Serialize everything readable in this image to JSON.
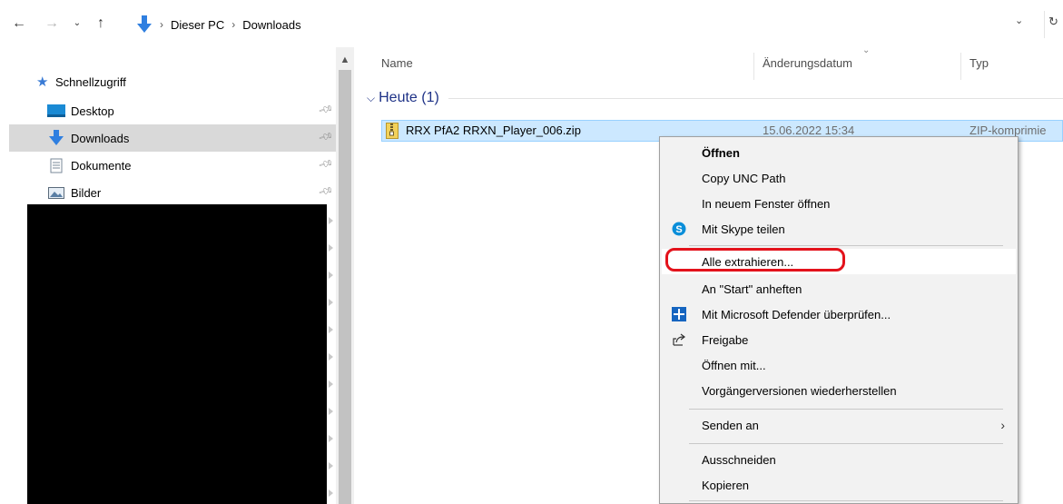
{
  "address_bar": {
    "back_icon": "arrow-left-icon",
    "forward_icon": "arrow-right-icon",
    "recent_icon": "chevron-down-icon",
    "up_icon": "arrow-up-icon",
    "breadcrumbs": [
      "Dieser PC",
      "Downloads"
    ],
    "refresh_icon": "refresh-icon"
  },
  "nav_pane": {
    "quick_access": "Schnellzugriff",
    "items": [
      {
        "label": "Desktop",
        "icon": "desktop-icon"
      },
      {
        "label": "Downloads",
        "icon": "download-arrow-icon",
        "selected": true
      },
      {
        "label": "Dokumente",
        "icon": "document-icon"
      },
      {
        "label": "Bilder",
        "icon": "pictures-icon"
      }
    ]
  },
  "file_list": {
    "columns": [
      "Name",
      "Änderungsdatum",
      "Typ"
    ],
    "group": {
      "title": "Heute (1)"
    },
    "files": [
      {
        "name": "RRX PfA2 RRXN_Player_006.zip",
        "date": "15.06.2022 15:34",
        "type": "ZIP-komprimie"
      }
    ]
  },
  "context_menu": {
    "items": [
      {
        "label": "Öffnen",
        "bold": true
      },
      {
        "label": "Copy UNC Path"
      },
      {
        "label": "In neuem Fenster öffnen"
      },
      {
        "label": "Mit Skype teilen",
        "icon": "skype-icon"
      },
      {
        "label": "Alle extrahieren..."
      },
      {
        "label": "An \"Start\" anheften"
      },
      {
        "label": "Mit Microsoft Defender überprüfen...",
        "icon": "defender-shield-icon"
      },
      {
        "label": "Freigabe",
        "icon": "share-icon"
      },
      {
        "label": "Öffnen mit..."
      },
      {
        "label": "Vorgängerversionen wiederherstellen"
      },
      {
        "label": "Senden an",
        "submenu": true
      },
      {
        "label": "Ausschneiden"
      },
      {
        "label": "Kopieren"
      }
    ],
    "highlight_color": "#e3121b"
  },
  "colors": {
    "selection_bg": "#cce8ff",
    "group_title": "#1e3287",
    "nav_selected_bg": "#d9d9d9"
  }
}
